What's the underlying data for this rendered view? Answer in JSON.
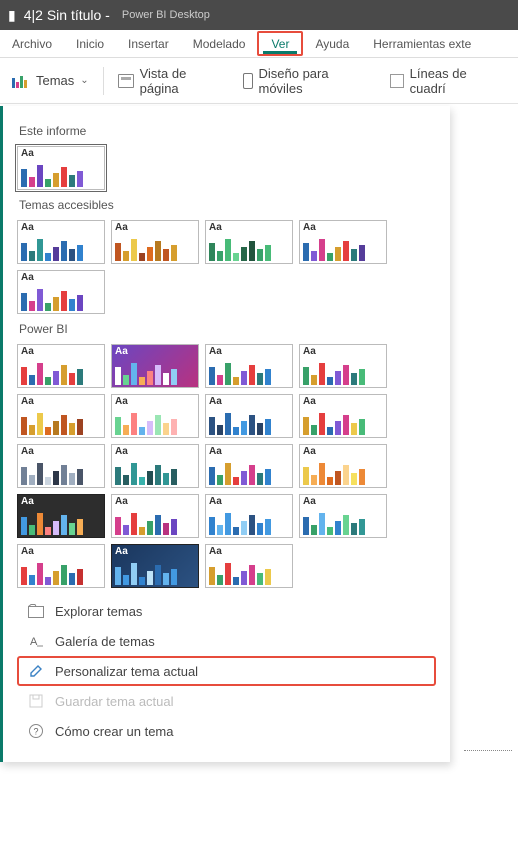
{
  "titlebar": {
    "doc_title": "4|2 Sin título -",
    "app_name": "Power BI Desktop"
  },
  "tabs": {
    "archivo": "Archivo",
    "inicio": "Inicio",
    "insertar": "Insertar",
    "modelado": "Modelado",
    "ver": "Ver",
    "ayuda": "Ayuda",
    "herramientas": "Herramientas exte"
  },
  "ribbon": {
    "temas": "Temas",
    "vista_pagina": "Vista de página",
    "diseno_moviles": "Diseño para móviles",
    "lineas_cuadricula": "Líneas de cuadrí"
  },
  "sections": {
    "este_informe": "Este informe",
    "temas_accesibles": "Temas accesibles",
    "power_bi": "Power BI"
  },
  "aa_label": "Aa",
  "footer": {
    "explorar": "Explorar temas",
    "galeria": "Galería de temas",
    "personalizar": "Personalizar tema actual",
    "guardar": "Guardar tema actual",
    "como_crear": "Cómo crear un tema"
  },
  "themes": {
    "este_informe": [
      {
        "bg": "#fff",
        "aa": "#333",
        "bars": [
          [
            "#2b6cb0",
            18
          ],
          [
            "#d53f8c",
            10
          ],
          [
            "#6b46c1",
            22
          ],
          [
            "#38a169",
            8
          ],
          [
            "#d69e2e",
            14
          ],
          [
            "#e53e3e",
            20
          ],
          [
            "#2c7a7b",
            12
          ],
          [
            "#805ad5",
            16
          ]
        ]
      }
    ],
    "accesibles": [
      {
        "bg": "#fff",
        "aa": "#333",
        "bars": [
          [
            "#2b6cb0",
            18
          ],
          [
            "#2c7a7b",
            10
          ],
          [
            "#319795",
            22
          ],
          [
            "#3182ce",
            8
          ],
          [
            "#553c9a",
            14
          ],
          [
            "#2b6cb0",
            20
          ],
          [
            "#2c5282",
            12
          ],
          [
            "#3182ce",
            16
          ]
        ]
      },
      {
        "bg": "#fff",
        "aa": "#333",
        "bars": [
          [
            "#c05621",
            18
          ],
          [
            "#d69e2e",
            10
          ],
          [
            "#ecc94b",
            22
          ],
          [
            "#9c4221",
            8
          ],
          [
            "#dd6b20",
            14
          ],
          [
            "#b7791f",
            20
          ],
          [
            "#c05621",
            12
          ],
          [
            "#d69e2e",
            16
          ]
        ]
      },
      {
        "bg": "#fff",
        "aa": "#333",
        "bars": [
          [
            "#2f855a",
            18
          ],
          [
            "#38a169",
            10
          ],
          [
            "#48bb78",
            22
          ],
          [
            "#68d391",
            8
          ],
          [
            "#276749",
            14
          ],
          [
            "#22543d",
            20
          ],
          [
            "#38a169",
            12
          ],
          [
            "#48bb78",
            16
          ]
        ]
      },
      {
        "bg": "#fff",
        "aa": "#333",
        "bars": [
          [
            "#2b6cb0",
            18
          ],
          [
            "#805ad5",
            10
          ],
          [
            "#d53f8c",
            22
          ],
          [
            "#38a169",
            8
          ],
          [
            "#d69e2e",
            14
          ],
          [
            "#e53e3e",
            20
          ],
          [
            "#2c7a7b",
            12
          ],
          [
            "#553c9a",
            16
          ]
        ]
      },
      {
        "bg": "#fff",
        "aa": "#333",
        "bars": [
          [
            "#2b6cb0",
            18
          ],
          [
            "#d53f8c",
            10
          ],
          [
            "#805ad5",
            22
          ],
          [
            "#38a169",
            8
          ],
          [
            "#d69e2e",
            14
          ],
          [
            "#e53e3e",
            20
          ],
          [
            "#3182ce",
            12
          ],
          [
            "#6b46c1",
            16
          ]
        ]
      }
    ],
    "powerbi": [
      {
        "bg": "#fff",
        "aa": "#333",
        "bars": [
          [
            "#e53e3e",
            18
          ],
          [
            "#2b6cb0",
            10
          ],
          [
            "#d53f8c",
            22
          ],
          [
            "#38a169",
            8
          ],
          [
            "#805ad5",
            14
          ],
          [
            "#d69e2e",
            20
          ],
          [
            "#e53e3e",
            12
          ],
          [
            "#2c7a7b",
            16
          ]
        ]
      },
      {
        "bg": "linear-gradient(135deg,#6b46c1,#b83280)",
        "aa": "#fff",
        "bars": [
          [
            "#fff",
            18
          ],
          [
            "#68d391",
            10
          ],
          [
            "#63b3ed",
            22
          ],
          [
            "#f6ad55",
            8
          ],
          [
            "#fc8181",
            14
          ],
          [
            "#d6bcfa",
            20
          ],
          [
            "#fff",
            12
          ],
          [
            "#90cdf4",
            16
          ]
        ]
      },
      {
        "bg": "#fff",
        "aa": "#333",
        "bars": [
          [
            "#2b6cb0",
            18
          ],
          [
            "#d53f8c",
            10
          ],
          [
            "#38a169",
            22
          ],
          [
            "#d69e2e",
            8
          ],
          [
            "#805ad5",
            14
          ],
          [
            "#e53e3e",
            20
          ],
          [
            "#2c7a7b",
            12
          ],
          [
            "#3182ce",
            16
          ]
        ]
      },
      {
        "bg": "#fff",
        "aa": "#333",
        "bars": [
          [
            "#38a169",
            18
          ],
          [
            "#d69e2e",
            10
          ],
          [
            "#e53e3e",
            22
          ],
          [
            "#2b6cb0",
            8
          ],
          [
            "#805ad5",
            14
          ],
          [
            "#d53f8c",
            20
          ],
          [
            "#2c7a7b",
            12
          ],
          [
            "#48bb78",
            16
          ]
        ]
      },
      {
        "bg": "#fff",
        "aa": "#333",
        "bars": [
          [
            "#c05621",
            18
          ],
          [
            "#d69e2e",
            10
          ],
          [
            "#ecc94b",
            22
          ],
          [
            "#dd6b20",
            8
          ],
          [
            "#b7791f",
            14
          ],
          [
            "#c05621",
            20
          ],
          [
            "#d69e2e",
            12
          ],
          [
            "#9c4221",
            16
          ]
        ]
      },
      {
        "bg": "#fff",
        "aa": "#333",
        "bars": [
          [
            "#68d391",
            18
          ],
          [
            "#f6ad55",
            10
          ],
          [
            "#fc8181",
            22
          ],
          [
            "#63b3ed",
            8
          ],
          [
            "#d6bcfa",
            14
          ],
          [
            "#9ae6b4",
            20
          ],
          [
            "#fbd38d",
            12
          ],
          [
            "#feb2b2",
            16
          ]
        ]
      },
      {
        "bg": "#fff",
        "aa": "#333",
        "bars": [
          [
            "#2c5282",
            18
          ],
          [
            "#2a4365",
            10
          ],
          [
            "#2b6cb0",
            22
          ],
          [
            "#3182ce",
            8
          ],
          [
            "#4299e1",
            14
          ],
          [
            "#2c5282",
            20
          ],
          [
            "#2a4365",
            12
          ],
          [
            "#3182ce",
            16
          ]
        ]
      },
      {
        "bg": "#fff",
        "aa": "#333",
        "bars": [
          [
            "#d69e2e",
            18
          ],
          [
            "#38a169",
            10
          ],
          [
            "#e53e3e",
            22
          ],
          [
            "#2b6cb0",
            8
          ],
          [
            "#805ad5",
            14
          ],
          [
            "#d53f8c",
            20
          ],
          [
            "#ecc94b",
            12
          ],
          [
            "#48bb78",
            16
          ]
        ]
      },
      {
        "bg": "#fff",
        "aa": "#333",
        "bars": [
          [
            "#718096",
            18
          ],
          [
            "#a0aec0",
            10
          ],
          [
            "#4a5568",
            22
          ],
          [
            "#cbd5e0",
            8
          ],
          [
            "#2d3748",
            14
          ],
          [
            "#718096",
            20
          ],
          [
            "#a0aec0",
            12
          ],
          [
            "#4a5568",
            16
          ]
        ]
      },
      {
        "bg": "#fff",
        "aa": "#333",
        "bars": [
          [
            "#2c7a7b",
            18
          ],
          [
            "#285e61",
            10
          ],
          [
            "#319795",
            22
          ],
          [
            "#38b2ac",
            8
          ],
          [
            "#234e52",
            14
          ],
          [
            "#2c7a7b",
            20
          ],
          [
            "#319795",
            12
          ],
          [
            "#285e61",
            16
          ]
        ]
      },
      {
        "bg": "#fff",
        "aa": "#333",
        "bars": [
          [
            "#2b6cb0",
            18
          ],
          [
            "#38a169",
            10
          ],
          [
            "#d69e2e",
            22
          ],
          [
            "#e53e3e",
            8
          ],
          [
            "#805ad5",
            14
          ],
          [
            "#d53f8c",
            20
          ],
          [
            "#2c7a7b",
            12
          ],
          [
            "#3182ce",
            16
          ]
        ]
      },
      {
        "bg": "#fff",
        "aa": "#333",
        "bars": [
          [
            "#ecc94b",
            18
          ],
          [
            "#f6ad55",
            10
          ],
          [
            "#ed8936",
            22
          ],
          [
            "#dd6b20",
            8
          ],
          [
            "#c05621",
            14
          ],
          [
            "#fbd38d",
            20
          ],
          [
            "#f6e05e",
            12
          ],
          [
            "#ed8936",
            16
          ]
        ]
      },
      {
        "bg": "#2d2d2d",
        "aa": "#fff",
        "bars": [
          [
            "#4299e1",
            18
          ],
          [
            "#48bb78",
            10
          ],
          [
            "#ed8936",
            22
          ],
          [
            "#fc8181",
            8
          ],
          [
            "#d6bcfa",
            14
          ],
          [
            "#63b3ed",
            20
          ],
          [
            "#68d391",
            12
          ],
          [
            "#f6ad55",
            16
          ]
        ],
        "dark": true
      },
      {
        "bg": "#fff",
        "aa": "#333",
        "bars": [
          [
            "#d53f8c",
            18
          ],
          [
            "#805ad5",
            10
          ],
          [
            "#e53e3e",
            22
          ],
          [
            "#d69e2e",
            8
          ],
          [
            "#38a169",
            14
          ],
          [
            "#2b6cb0",
            20
          ],
          [
            "#b83280",
            12
          ],
          [
            "#6b46c1",
            16
          ]
        ]
      },
      {
        "bg": "#fff",
        "aa": "#333",
        "bars": [
          [
            "#3182ce",
            18
          ],
          [
            "#63b3ed",
            10
          ],
          [
            "#4299e1",
            22
          ],
          [
            "#2b6cb0",
            8
          ],
          [
            "#90cdf4",
            14
          ],
          [
            "#2c5282",
            20
          ],
          [
            "#3182ce",
            12
          ],
          [
            "#4299e1",
            16
          ]
        ]
      },
      {
        "bg": "#fff",
        "aa": "#333",
        "bars": [
          [
            "#2b6cb0",
            18
          ],
          [
            "#38a169",
            10
          ],
          [
            "#63b3ed",
            22
          ],
          [
            "#48bb78",
            8
          ],
          [
            "#3182ce",
            14
          ],
          [
            "#68d391",
            20
          ],
          [
            "#2c7a7b",
            12
          ],
          [
            "#319795",
            16
          ]
        ]
      },
      {
        "bg": "#fff",
        "aa": "#333",
        "bars": [
          [
            "#e53e3e",
            18
          ],
          [
            "#3182ce",
            10
          ],
          [
            "#d53f8c",
            22
          ],
          [
            "#805ad5",
            8
          ],
          [
            "#d69e2e",
            14
          ],
          [
            "#38a169",
            20
          ],
          [
            "#2b6cb0",
            12
          ],
          [
            "#c53030",
            16
          ]
        ]
      },
      {
        "bg": "linear-gradient(135deg,#1a365d,#2c5282)",
        "aa": "#fff",
        "bars": [
          [
            "#63b3ed",
            18
          ],
          [
            "#4299e1",
            10
          ],
          [
            "#90cdf4",
            22
          ],
          [
            "#3182ce",
            8
          ],
          [
            "#bee3f8",
            14
          ],
          [
            "#2b6cb0",
            20
          ],
          [
            "#63b3ed",
            12
          ],
          [
            "#4299e1",
            16
          ]
        ],
        "dark": true
      },
      {
        "bg": "#fff",
        "aa": "#333",
        "bars": [
          [
            "#d69e2e",
            18
          ],
          [
            "#38a169",
            10
          ],
          [
            "#e53e3e",
            22
          ],
          [
            "#2b6cb0",
            8
          ],
          [
            "#805ad5",
            14
          ],
          [
            "#d53f8c",
            20
          ],
          [
            "#48bb78",
            12
          ],
          [
            "#ecc94b",
            16
          ]
        ]
      }
    ]
  }
}
